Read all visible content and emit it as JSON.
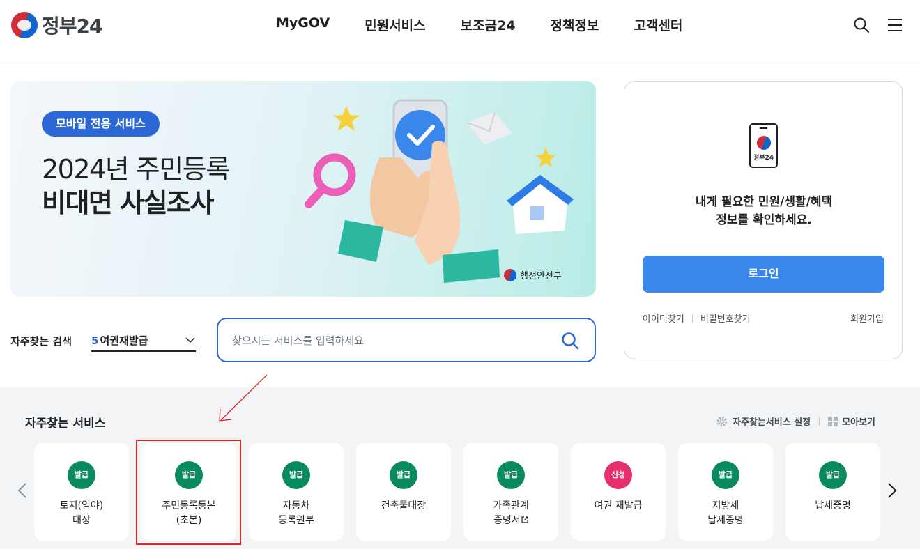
{
  "header": {
    "logo_text": "정부24",
    "nav": [
      "MyGOV",
      "민원서비스",
      "보조금24",
      "정책정보",
      "고객센터"
    ],
    "icons": [
      "search-icon",
      "menu-icon"
    ]
  },
  "banner": {
    "badge": "모바일 전용 서비스",
    "title_line1": "2024년 주민등록",
    "title_line2": "비대면 사실조사",
    "ministry": "행정안전부"
  },
  "search": {
    "label": "자주찾는 검색",
    "select_rank": "5",
    "select_value": "여권재발급",
    "placeholder": "찾으시는 서비스를 입력하세요"
  },
  "login": {
    "phone_text": "정부24",
    "message_line1": "내게 필요한 민원/생활/혜택",
    "message_line2": "정보를 확인하세요.",
    "button": "로그인",
    "find_id": "아이디찾기",
    "find_pw": "비밀번호찾기",
    "signup": "회원가입"
  },
  "services": {
    "title": "자주찾는 서비스",
    "settings": "자주찾는서비스 설정",
    "view_all": "모아보기",
    "items": [
      {
        "badge": "발급",
        "type": "issue",
        "label": "토지(임야)\n대장"
      },
      {
        "badge": "발급",
        "type": "issue",
        "label": "주민등록등본\n(초본)"
      },
      {
        "badge": "발급",
        "type": "issue",
        "label": "자동차\n등록원부"
      },
      {
        "badge": "발급",
        "type": "issue",
        "label": "건축물대장"
      },
      {
        "badge": "발급",
        "type": "issue",
        "label": "가족관계\n증명서"
      },
      {
        "badge": "신청",
        "type": "apply",
        "label": "여권 재발급"
      },
      {
        "badge": "발급",
        "type": "issue",
        "label": "지방세\n납세증명"
      },
      {
        "badge": "발급",
        "type": "issue",
        "label": "납세증명"
      }
    ]
  },
  "colors": {
    "primary": "#2c67d6",
    "login_button": "#3a88ec",
    "issue_badge": "#0a8a5f",
    "apply_badge": "#e5306c",
    "annotation": "#e52222"
  }
}
